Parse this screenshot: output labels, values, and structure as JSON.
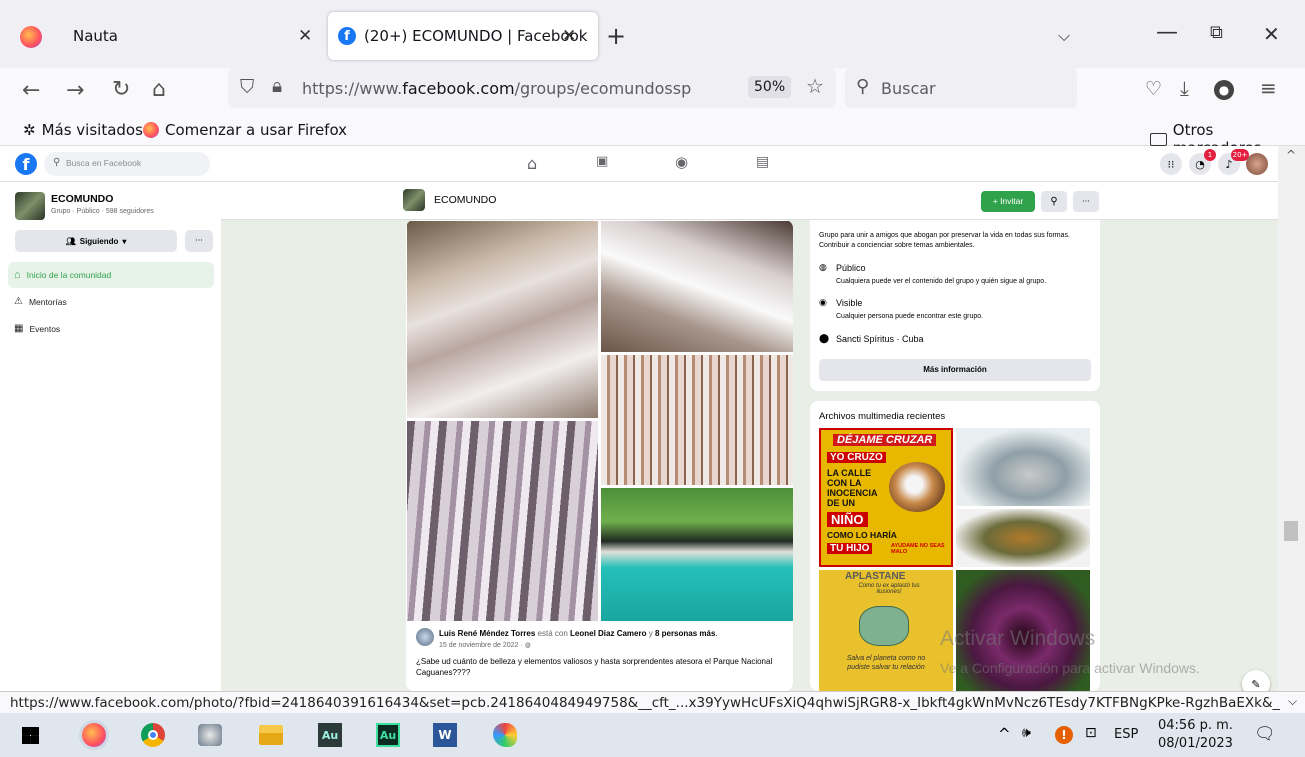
{
  "browser": {
    "tabs": [
      {
        "title": "Nauta"
      },
      {
        "title": "(20+) ECOMUNDO | Facebook"
      }
    ],
    "url_prefix": "https://www.",
    "url_domain": "facebook.com",
    "url_path": "/groups/ecomundossp",
    "zoom": "50%",
    "search_placeholder": "Buscar",
    "bookmarks": [
      {
        "label": "Más visitados"
      },
      {
        "label": "Comenzar a usar Firefox"
      }
    ],
    "other_bookmarks": "Otros marcadores",
    "status_url": "https://www.facebook.com/photo/?fbid=2418640391616434&set=pcb.2418640484949758&__cft_...x39YywHcUFsXiQ4qhwiSjRGR8-x_Ibkft4gkWnMvNcz6TEsdy7KTFBNgKPke-RgzhBaEXk&__tn_=*bH-y-R"
  },
  "facebook": {
    "search_placeholder": "Busca en Facebook",
    "messenger_badge": "1",
    "notif_badge": "20+",
    "group": {
      "name": "ECOMUNDO",
      "meta": "Grupo · Público · 598 seguidores",
      "following_label": "Siguiendo",
      "more_label": "···"
    },
    "left_menu": [
      {
        "label": "Inicio de la comunidad"
      },
      {
        "label": "Mentorías"
      },
      {
        "label": "Eventos"
      }
    ],
    "header": {
      "name": "ECOMUNDO",
      "invite_label": "+ Invitar",
      "more_label": "···"
    },
    "about": {
      "description": "Grupo para unir a amigos que abogan por preservar la vida en todas sus formas. Contribuir a concienciar sobre temas ambientales.",
      "public_title": "Público",
      "public_text": "Cualquiera puede ver el contenido del grupo y quién sigue al grupo.",
      "visible_title": "Visible",
      "visible_text": "Cualquier persona puede encontrar este grupo.",
      "location": "Sancti Spíritus · Cuba",
      "more_info": "Más información"
    },
    "media_title": "Archivos multimedia recientes",
    "media_texts": {
      "poster1_top": "DÉJAME CRUZAR",
      "poster1_mid": "YO CRUZO",
      "poster1_body": "LA CALLE CON LA INOCENCIA DE UN",
      "poster1_nino": "NIÑO",
      "poster1_como": "COMO LO HARÍA",
      "poster1_hijo": "TU HIJO",
      "poster1_ayud": "AYUDAME NO SEAS MALO",
      "poster2_top": "APLASTANE",
      "poster2_a": "Como tu ex aplastó tus ilusiones!",
      "poster2_b": "Salva el planeta como no pudiste salvar tu relación"
    },
    "post": {
      "author": "Luis René Méndez Torres",
      "with_text": " está con ",
      "with_name": "Leonel Diaz Camero",
      "and_text": " y ",
      "others": "8 personas más",
      "date": "15 de noviembre de 2022 · ",
      "body": "¿Sabe ud cuánto de belleza y elementos valiosos y hasta sorprendentes atesora el Parque Nacional Caguanes????"
    },
    "watermark_title": "Activar Windows",
    "watermark_sub": "Ve a Configuración para activar Windows."
  },
  "taskbar": {
    "clock_time": "04:56 p. m.",
    "clock_date": "08/01/2023",
    "lang": "ESP"
  },
  "colors": {
    "fb_blue": "#1877f2",
    "fb_green": "#31a24c",
    "active_bg": "#e7f3e8",
    "taskbar": "#dfe6ee"
  }
}
